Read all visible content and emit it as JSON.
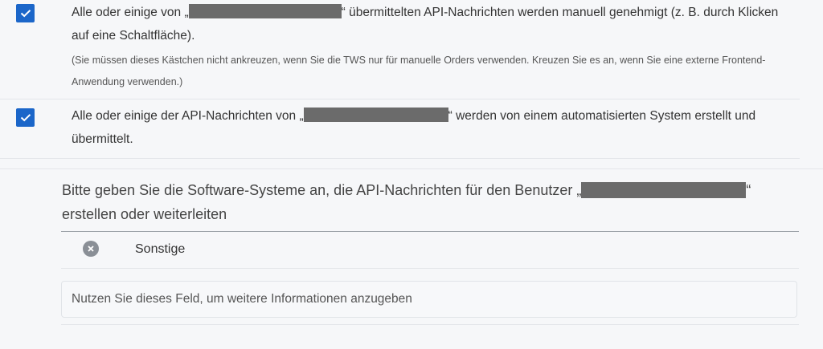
{
  "consent": {
    "item1": {
      "checked": true,
      "text_before": "Alle oder einige von „",
      "text_after": "“ übermittelten API-Nachrichten werden manuell genehmigt (z. B. durch Klicken auf eine Schaltfläche).",
      "note": "(Sie müssen dieses Kästchen nicht ankreuzen, wenn Sie die TWS nur für manuelle Orders verwenden. Kreuzen Sie es an, wenn Sie eine externe Frontend-Anwendung verwenden.)"
    },
    "item2": {
      "checked": true,
      "text_before": "Alle oder einige der API-Nachrichten von „",
      "text_after": "“ werden von einem automatisierten System erstellt und übermittelt."
    }
  },
  "software": {
    "question_before": "Bitte geben Sie die Software-Systeme an, die API-Nachrichten für den Benutzer „",
    "question_after": "“ erstellen oder weiterleiten",
    "selected_items": [
      {
        "label": "Sonstige"
      }
    ],
    "info_placeholder": "Nutzen Sie dieses Feld, um weitere Informationen anzugeben",
    "info_value": ""
  },
  "colors": {
    "checkbox": "#1b66c9",
    "redaction": "#6b6b6b"
  },
  "icons": {
    "check": "check-icon",
    "remove": "remove-circle-icon"
  }
}
